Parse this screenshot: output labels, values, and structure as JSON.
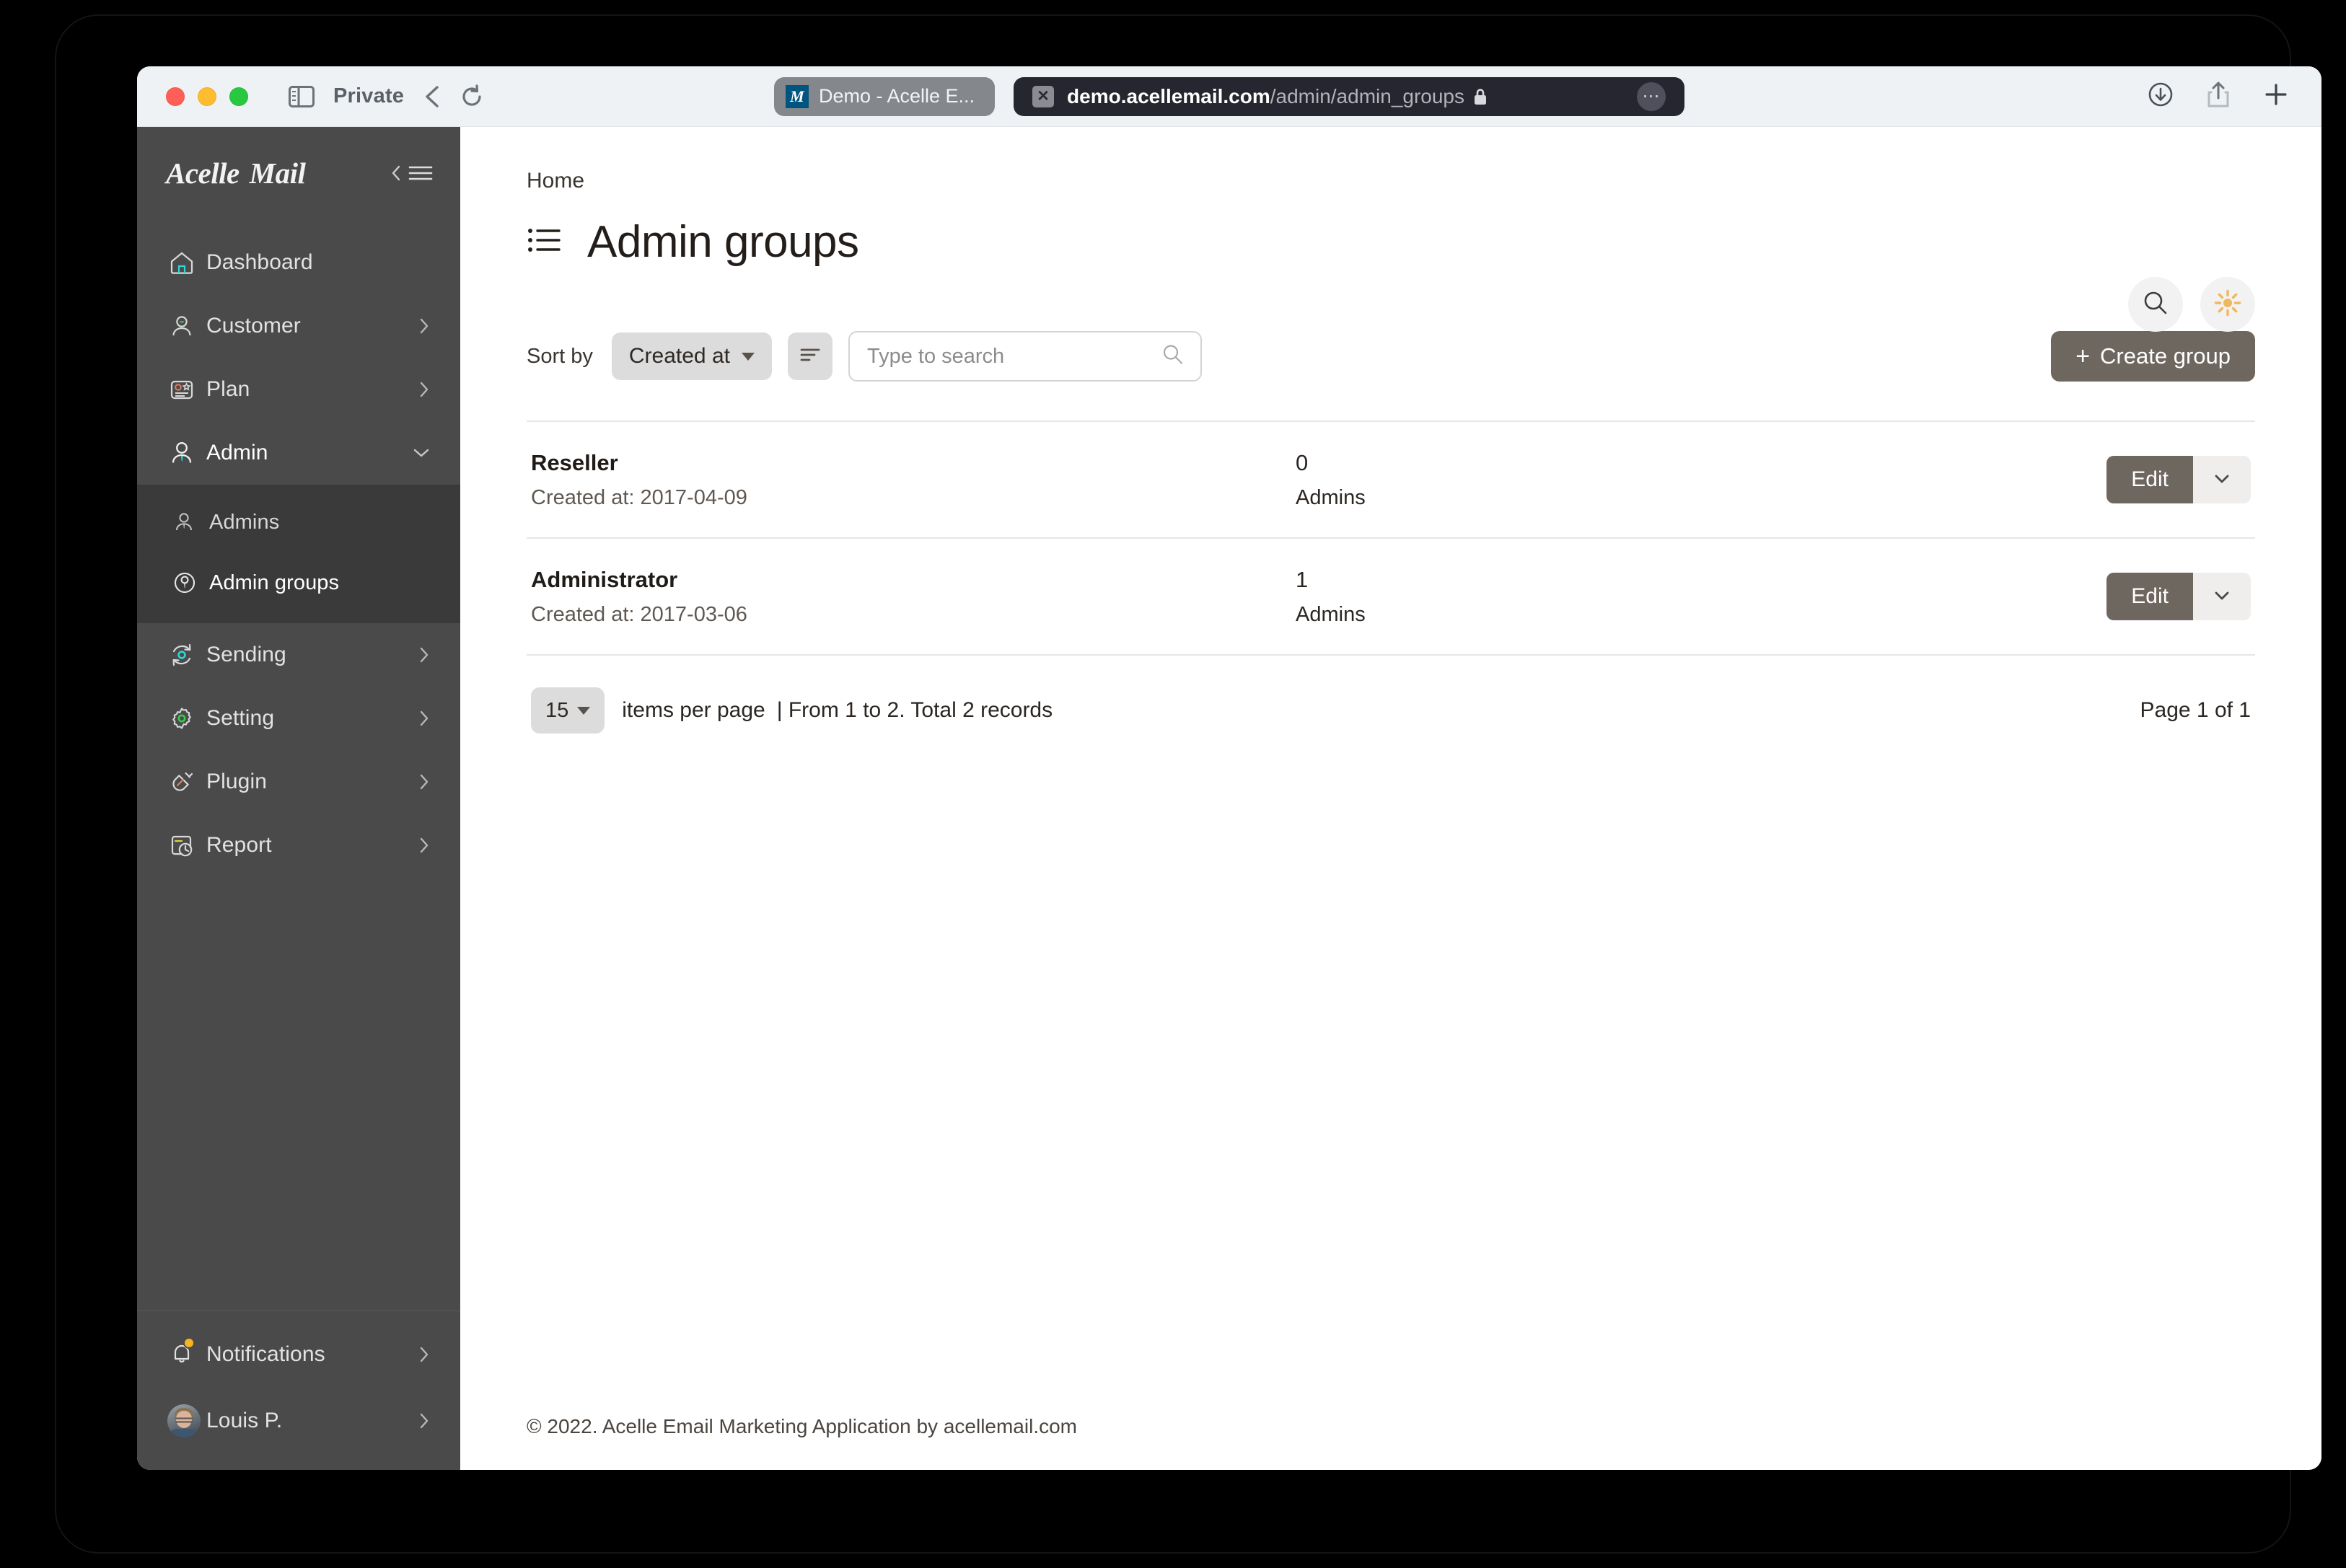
{
  "browser": {
    "private_label": "Private",
    "tab": {
      "title": "Demo - Acelle E...",
      "favicon_letter": "M"
    },
    "url": {
      "host": "demo.acellemail.com",
      "path": "/admin/admin_groups"
    }
  },
  "sidebar": {
    "brand": "Acelle Mail",
    "items": [
      {
        "label": "Dashboard",
        "icon": "home-icon",
        "expandable": false
      },
      {
        "label": "Customer",
        "icon": "user-icon",
        "expandable": true
      },
      {
        "label": "Plan",
        "icon": "plan-card-icon",
        "expandable": true
      },
      {
        "label": "Admin",
        "icon": "admin-user-icon",
        "expandable": true,
        "open": true
      }
    ],
    "sub_items": [
      {
        "label": "Admins",
        "icon": "admins-icon",
        "active": false
      },
      {
        "label": "Admin groups",
        "icon": "admin-groups-icon",
        "active": true
      }
    ],
    "items_after": [
      {
        "label": "Sending",
        "icon": "sending-sync-icon",
        "expandable": true
      },
      {
        "label": "Setting",
        "icon": "gear-icon",
        "expandable": true
      },
      {
        "label": "Plugin",
        "icon": "plug-icon",
        "expandable": true
      },
      {
        "label": "Report",
        "icon": "report-clock-icon",
        "expandable": true
      }
    ],
    "bottom": [
      {
        "label": "Notifications",
        "icon": "bell-icon",
        "badge": true
      },
      {
        "label": "Louis P.",
        "icon": "avatar",
        "badge": false
      }
    ]
  },
  "header": {
    "breadcrumb": "Home",
    "title": "Admin groups",
    "search_icon": "search-icon",
    "theme_icon": "sun-icon"
  },
  "toolbar": {
    "sort_by_label": "Sort by",
    "sort_value": "Created at",
    "sort_direction_icon": "sort-descending-icon",
    "search_placeholder": "Type to search",
    "search_value": "",
    "create_label": "Create group",
    "create_plus": "+"
  },
  "table": {
    "rows": [
      {
        "name": "Reseller",
        "created": "Created at: 2017-04-09",
        "count": "0",
        "count_label": "Admins",
        "edit_label": "Edit"
      },
      {
        "name": "Administrator",
        "created": "Created at: 2017-03-06",
        "count": "1",
        "count_label": "Admins",
        "edit_label": "Edit"
      }
    ]
  },
  "pagination": {
    "per_page": "15",
    "per_page_label": "items per page",
    "range_info": "| From 1 to 2. Total 2 records",
    "page_info": "Page 1 of 1"
  },
  "footer": {
    "copyright": "© 2022. Acelle Email Marketing Application by acellemail.com"
  },
  "colors": {
    "sidebar_bg": "#4a4a4a",
    "subnav_bg": "#3a3a3a",
    "primary_button": "#6e675f",
    "accent_sun": "#efb75e",
    "badge": "#f5b422"
  }
}
